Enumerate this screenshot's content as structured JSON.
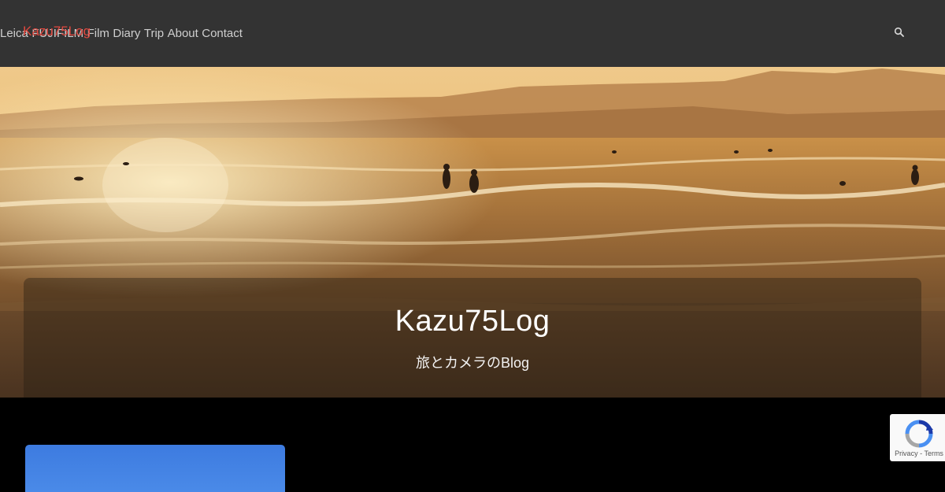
{
  "header": {
    "logo_text": "Kazu75Log",
    "logo_color": "#e0483f",
    "background": "#333333",
    "nav": [
      {
        "label": "Leica"
      },
      {
        "label": "FUJIFILM"
      },
      {
        "label": "Film"
      },
      {
        "label": "Diary"
      },
      {
        "label": "Trip"
      },
      {
        "label": "About"
      },
      {
        "label": "Contact"
      }
    ],
    "search_icon": "search-icon"
  },
  "hero": {
    "title": "Kazu75Log",
    "subtitle": "旅とカメラのBlog",
    "image_description_icon": "sunset-beach-surfers-image"
  },
  "content": {
    "card_color": "#3d7be0"
  },
  "recaptcha": {
    "icon": "recaptcha-icon",
    "privacy": "Privacy",
    "separator": "-",
    "terms": "Terms"
  }
}
